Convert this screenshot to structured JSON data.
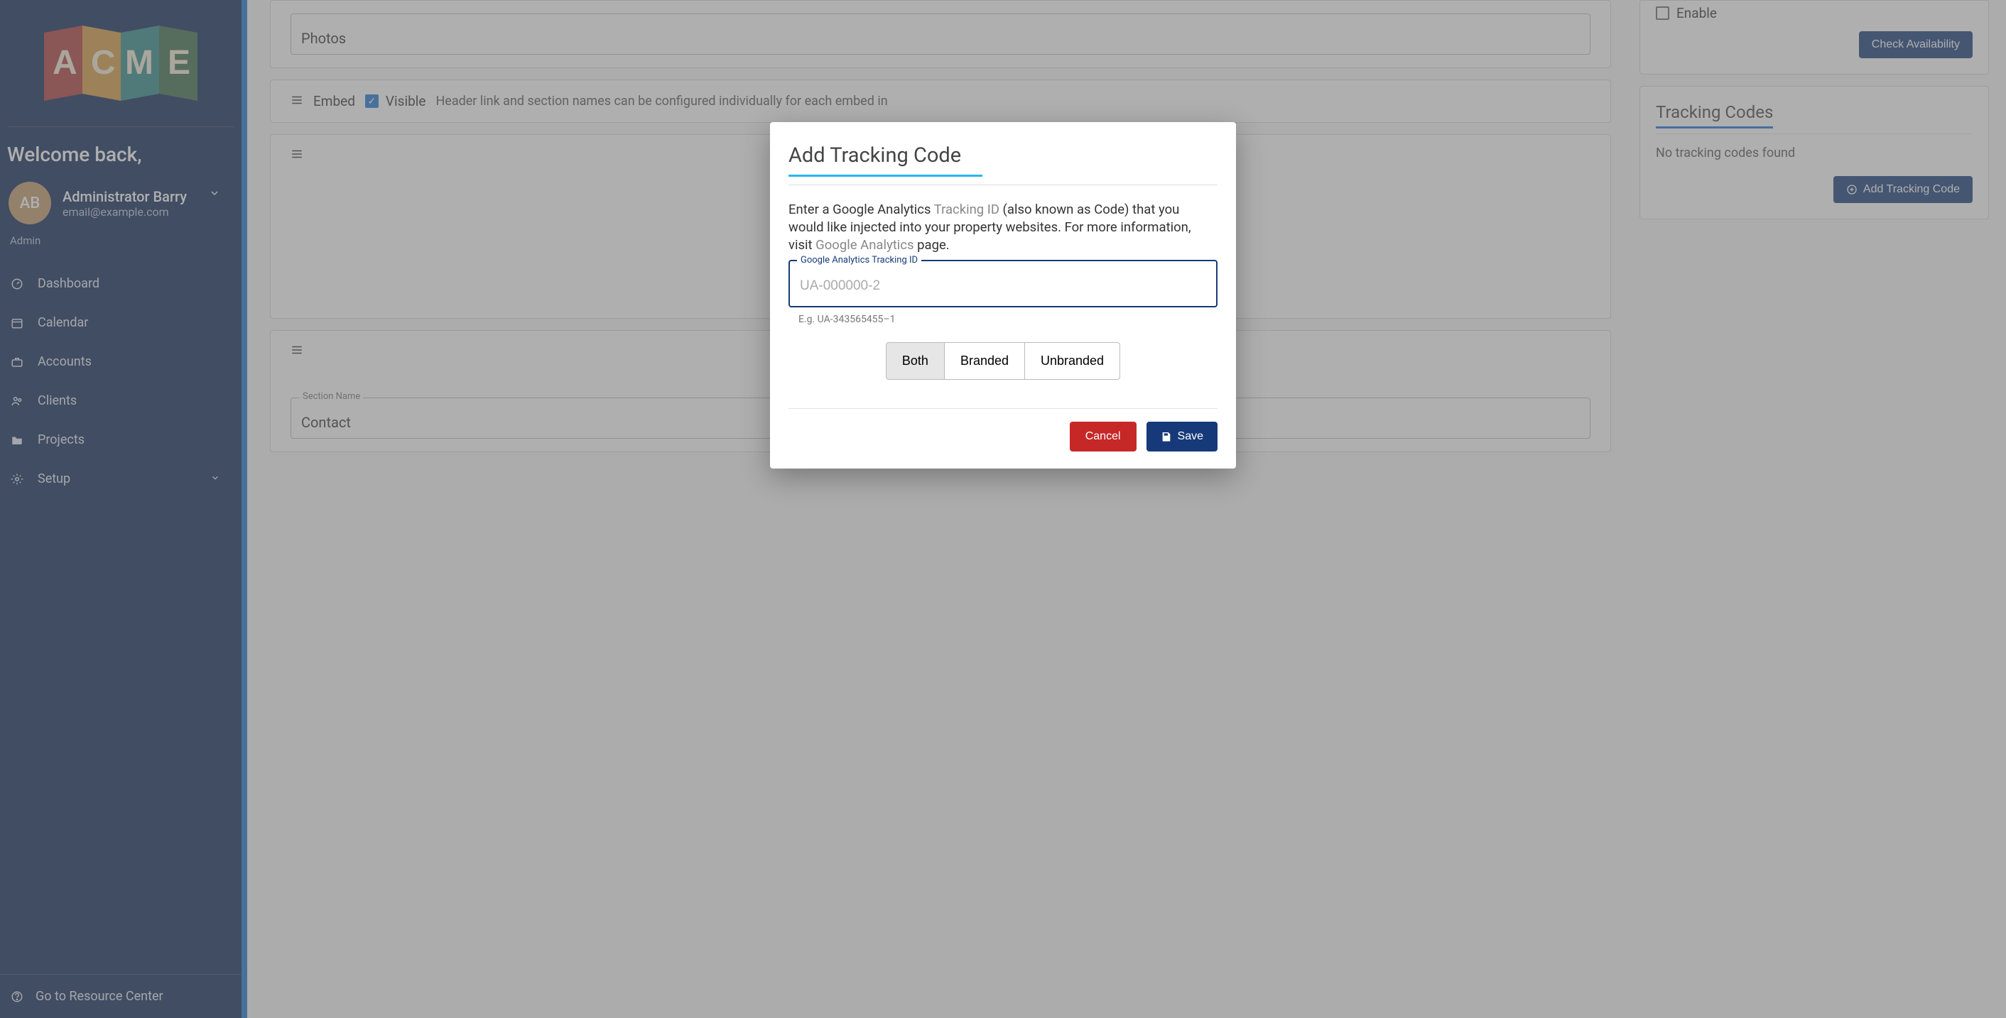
{
  "sidebar": {
    "welcome": "Welcome back,",
    "avatar_initials": "AB",
    "user_name": "Administrator Barry",
    "user_email": "email@example.com",
    "role": "Admin",
    "nav": {
      "dashboard": "Dashboard",
      "calendar": "Calendar",
      "accounts": "Accounts",
      "clients": "Clients",
      "projects": "Projects",
      "setup": "Setup"
    },
    "resource_link": "Go to Resource Center"
  },
  "main": {
    "photos_label": "Photos",
    "embed_label": "Embed",
    "visible_label": "Visible",
    "embed_helper": "Header link and section names can be configured individually for each embed in",
    "section_name_label": "Section Name",
    "section_name_value": "Contact"
  },
  "right": {
    "enable_label": "Enable",
    "check_avail": "Check Availability",
    "tracking_heading": "Tracking Codes",
    "no_codes": "No tracking codes found",
    "add_tracking": "Add Tracking Code"
  },
  "modal": {
    "title": "Add Tracking Code",
    "intro_1": "Enter a Google Analytics ",
    "link_1": "Tracking ID",
    "intro_2": " (also known as Code) that you would like injected into your property websites. For more information, visit ",
    "link_2": "Google Analytics",
    "intro_3": " page.",
    "field_label": "Google Analytics Tracking ID",
    "placeholder": "UA-000000-2",
    "hint": "E.g. UA-343565455–1",
    "seg": {
      "both": "Both",
      "branded": "Branded",
      "unbranded": "Unbranded"
    },
    "cancel": "Cancel",
    "save": "Save"
  },
  "colors": {
    "brand_navy": "#0d2757",
    "accent_blue": "#1976d2",
    "btn_primary": "#163a79",
    "btn_danger": "#c62828"
  }
}
